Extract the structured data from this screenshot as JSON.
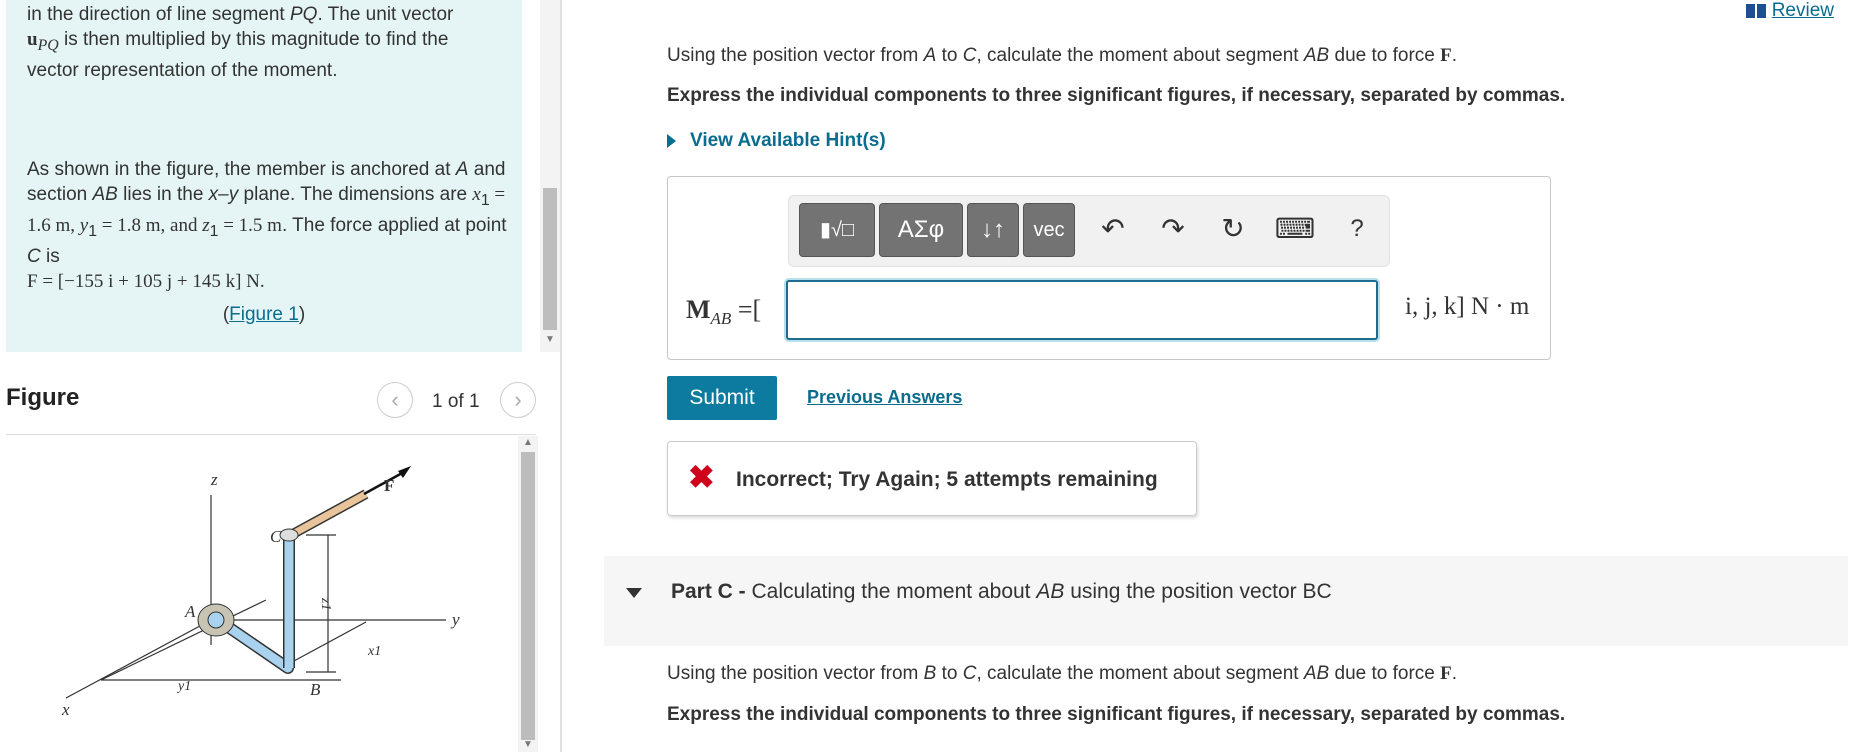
{
  "problem": {
    "para1_line1_a": "in the direction of line segment ",
    "para1_line1_pq": "PQ",
    "para1_line1_b": ". The unit vector",
    "para1_line2_u": "u",
    "para1_line2_sub": "PQ",
    "para1_line2_b": " is then multiplied by this magnitude to find the",
    "para1_line3": "vector representation of the moment.",
    "para2_a": "As shown in the figure, the member is anchored at ",
    "para2_A": "A",
    "para2_b": " and section ",
    "para2_AB": "AB",
    "para2_c": " lies in the ",
    "para2_xy": "x–y",
    "para2_d": " plane. The dimensions are ",
    "dim_x_sym": "x",
    "dim_x": " = 1.6 m, ",
    "dim_y_sym": "y",
    "dim_y": " = 1.8 m, and ",
    "dim_z_sym": "z",
    "dim_z": " = 1.5 m",
    "para2_e": ". The force applied at point ",
    "para2_C": "C",
    "para2_f": " is",
    "force_eq": "F = [−155 i + 105 j + 145 k] N.",
    "figure_link_open": "(",
    "figure_link": "Figure 1",
    "figure_link_close": ")"
  },
  "figure_panel": {
    "title": "Figure",
    "pager": "1 of 1",
    "prev": "‹",
    "next": "›",
    "labels": {
      "z": "z",
      "F": "F",
      "C": "C",
      "A": "A",
      "y": "y",
      "z1": "z1",
      "x1": "x1",
      "y1": "y1",
      "B": "B",
      "x": "x"
    }
  },
  "review": "Review",
  "question_b": {
    "l1_a": "Using the position vector from ",
    "l1_A": "A",
    "l1_b": " to ",
    "l1_C": "C",
    "l1_c": ", calculate the moment about segment ",
    "l1_AB": "AB",
    "l1_d": " due to force ",
    "l1_F": "F",
    "l1_e": ".",
    "instr": "Express the individual components to three significant figures, if necessary, separated by commas."
  },
  "hint_label": "View Available Hint(s)",
  "toolbar": {
    "templates": "▮√□",
    "greek": "ΑΣφ",
    "arrows": "↓↑",
    "vec": "vec",
    "undo": "↶",
    "redo": "↷",
    "reset": "↻",
    "keyboard": "⌨",
    "help": "?"
  },
  "answer": {
    "label_M": "M",
    "label_sub": "AB",
    "label_eq": " =[",
    "value": "",
    "units": "i, j, k] N · m"
  },
  "submit_label": "Submit",
  "previous_answers": "Previous Answers",
  "feedback": {
    "icon": "✖",
    "text": "Incorrect; Try Again; 5 attempts remaining"
  },
  "part_c": {
    "prefix": "Part C - ",
    "title": "Calculating the moment about ",
    "AB": "AB",
    "suffix": " using the position vector BC"
  },
  "question_c": {
    "l1_a": "Using the position vector from ",
    "l1_B": "B",
    "l1_b": " to ",
    "l1_C": "C",
    "l1_c": ", calculate the moment about segment ",
    "l1_AB": "AB",
    "l1_d": " due to force ",
    "l1_F": "F",
    "l1_e": ".",
    "instr": "Express the individual components to three significant figures, if necessary, separated by commas."
  },
  "colors": {
    "accent": "#0d7ba0",
    "link": "#0a6c8f",
    "problem_bg": "#e5f5f6",
    "error": "#d0021b"
  }
}
